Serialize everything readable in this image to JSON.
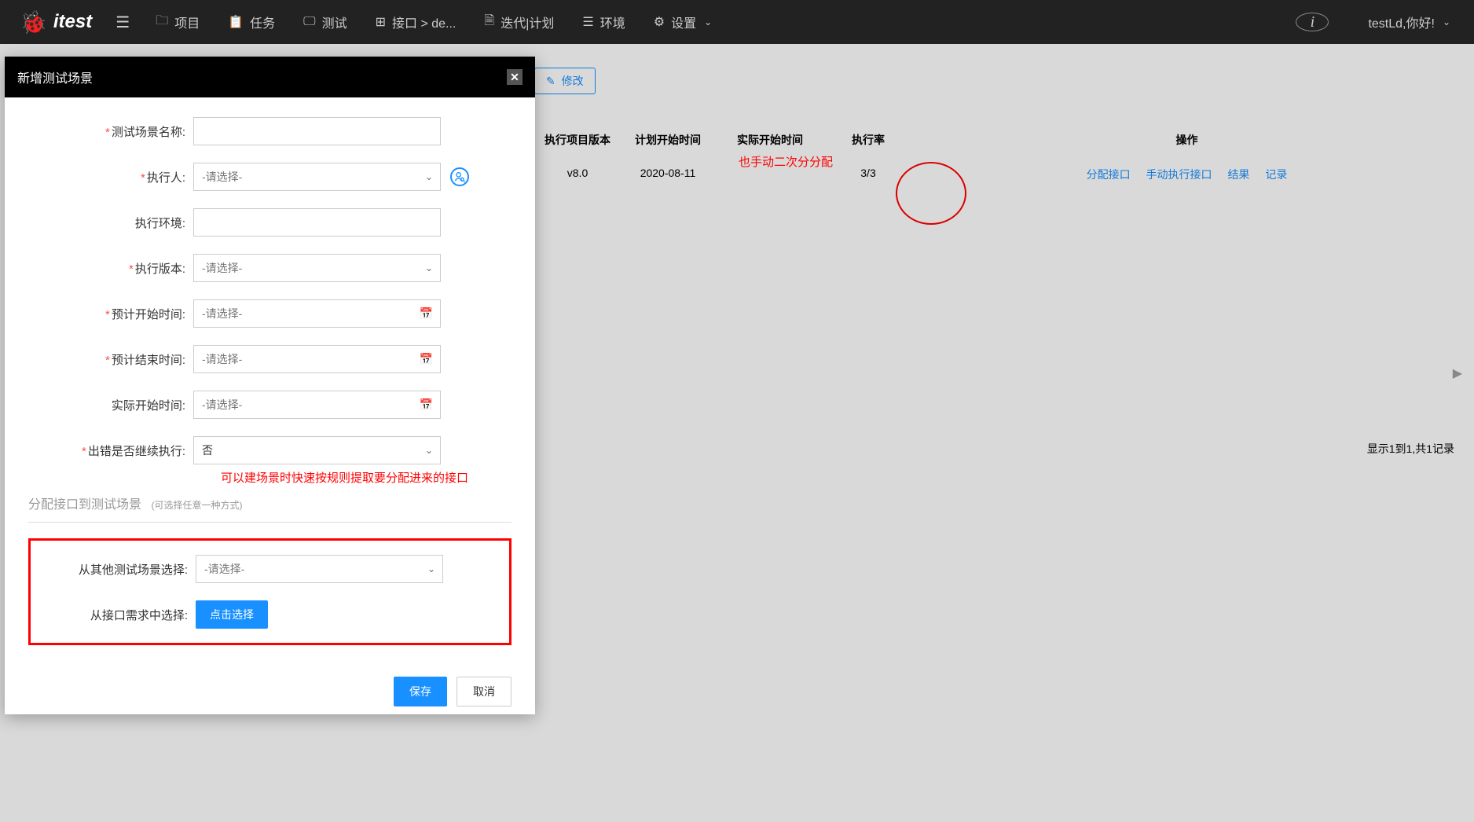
{
  "header": {
    "logo_text": "itest",
    "nav": {
      "project": "项目",
      "task": "任务",
      "test": "测试",
      "interface": "接口 > de...",
      "iteration": "迭代|计划",
      "env": "环境",
      "settings": "设置"
    },
    "user_greeting": "testLd,你好!"
  },
  "background": {
    "modify_btn": "修改",
    "table_headers": {
      "version": "执行项目版本",
      "plan_start": "计划开始时间",
      "actual_start": "实际开始时间",
      "exec_rate": "执行率",
      "actions": "操作"
    },
    "table_row": {
      "version": "v8.0",
      "plan_start": "2020-08-11",
      "actual_start": "",
      "exec_rate": "3/3",
      "actions": {
        "assign": "分配接口",
        "manual": "手动执行接口",
        "result": "结果",
        "record": "记录"
      }
    },
    "annotation1": "也手动二次分分配",
    "pagination": "显示1到1,共1记录"
  },
  "modal": {
    "title": "新增测试场景",
    "labels": {
      "scene_name": "测试场景名称:",
      "executor": "执行人:",
      "env": "执行环境:",
      "version": "执行版本:",
      "plan_start": "预计开始时间:",
      "plan_end": "预计结束时间:",
      "actual_start": "实际开始时间:",
      "continue_on_error": "出错是否继续执行:",
      "from_other_scene": "从其他测试场景选择:",
      "from_requirement": "从接口需求中选择:"
    },
    "placeholders": {
      "select": "-请选择-"
    },
    "values": {
      "continue_on_error": "否"
    },
    "annotation2": "可以建场景时快速按规则提取要分配进来的接口",
    "section_title": "分配接口到测试场景",
    "section_subtitle": "(可选择任意一种方式)",
    "click_select_btn": "点击选择",
    "save_btn": "保存",
    "cancel_btn": "取消"
  }
}
